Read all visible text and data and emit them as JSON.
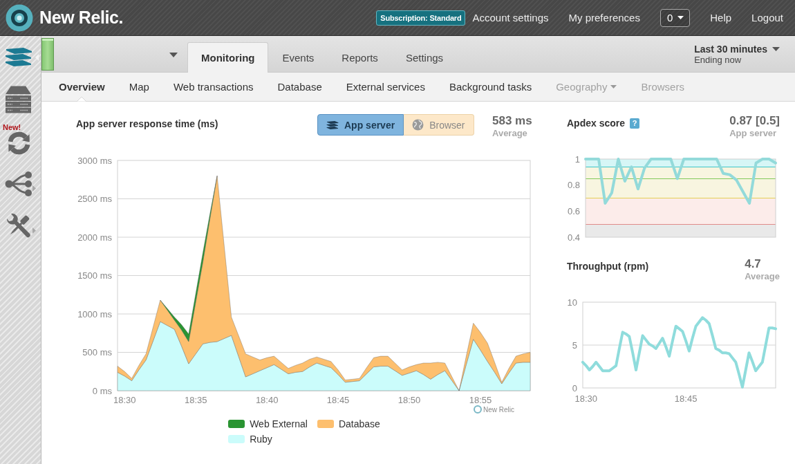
{
  "header": {
    "brand": "New Relic.",
    "menu": [
      {
        "kind": "badge",
        "label": "Subscription: Standard"
      },
      {
        "kind": "link",
        "label": "Account settings"
      },
      {
        "kind": "link",
        "label": "My preferences"
      },
      {
        "kind": "dropdown",
        "label": "0"
      },
      {
        "kind": "link",
        "label": "Help"
      },
      {
        "kind": "link",
        "label": "Logout"
      }
    ]
  },
  "sidebar": {
    "items": [
      {
        "selected": true,
        "submenu": false
      },
      {
        "selected": false,
        "submenu": false
      },
      {
        "badge": "New!",
        "selected": false,
        "submenu": false
      },
      {
        "selected": false,
        "submenu": true
      },
      {
        "selected": false,
        "submenu": true
      }
    ]
  },
  "tabs": [
    {
      "label": "Monitoring",
      "selected": true
    },
    {
      "label": "Events",
      "selected": false
    },
    {
      "label": "Reports",
      "selected": false
    },
    {
      "label": "Settings",
      "selected": false
    }
  ],
  "time_range": {
    "label": "Last 30 minutes",
    "sublabel": "Ending now"
  },
  "subnav": [
    {
      "label": "Overview",
      "selected": true,
      "disabled": false,
      "dropdown": false
    },
    {
      "label": "Map",
      "selected": false,
      "disabled": false,
      "dropdown": false
    },
    {
      "label": "Web transactions",
      "selected": false,
      "disabled": false,
      "dropdown": false
    },
    {
      "label": "Database",
      "selected": false,
      "disabled": false,
      "dropdown": false
    },
    {
      "label": "External services",
      "selected": false,
      "disabled": false,
      "dropdown": false
    },
    {
      "label": "Background tasks",
      "selected": false,
      "disabled": false,
      "dropdown": false
    },
    {
      "label": "Geography",
      "selected": false,
      "disabled": true,
      "dropdown": true
    },
    {
      "label": "Browsers",
      "selected": false,
      "disabled": true,
      "dropdown": false
    }
  ],
  "response_time": {
    "title": "App server response time (ms)",
    "toggle": [
      {
        "label": "App server",
        "selected": true
      },
      {
        "label": "Browser",
        "selected": false
      }
    ],
    "stat": {
      "value": "583 ms",
      "label": "Average"
    },
    "chart_data": {
      "type": "area",
      "stacked": true,
      "grid": true,
      "categories": [
        null,
        "18:30",
        null,
        null,
        null,
        null,
        null,
        null,
        null,
        null,
        null,
        "18:35",
        null,
        null,
        null,
        null,
        null,
        null,
        null,
        null,
        null,
        "18:40",
        null,
        null,
        null,
        null,
        null,
        null,
        null,
        null,
        null,
        "18:45",
        null,
        null,
        null,
        null,
        null,
        null,
        null,
        null,
        null,
        "18:50",
        null,
        null,
        null,
        null,
        null,
        null,
        null,
        null,
        null,
        "18:55",
        null,
        null,
        null,
        null,
        null,
        null,
        null
      ],
      "ylim": [
        0,
        3000
      ],
      "yticks": [
        {
          "value": 0,
          "label": "0 ms"
        },
        {
          "value": 500,
          "label": "500 ms"
        },
        {
          "value": 1000,
          "label": "1000 ms"
        },
        {
          "value": 1500,
          "label": "1500 ms"
        },
        {
          "value": 2000,
          "label": "2000 ms"
        },
        {
          "value": 2500,
          "label": "2500 ms"
        },
        {
          "value": 3000,
          "label": "3000 ms"
        }
      ],
      "series": [
        {
          "name": "Web External",
          "color": "#2a9432",
          "values": [
            null,
            null,
            null,
            null,
            null,
            null,
            0,
            20,
            40,
            70,
            100,
            110,
            120,
            60,
            0,
            null,
            null,
            null,
            null,
            null,
            null,
            null,
            null,
            null,
            null,
            null,
            null,
            null,
            null,
            null,
            null,
            null,
            null,
            null,
            null,
            null,
            null,
            null,
            null,
            null,
            null,
            null,
            null,
            null,
            null,
            null,
            null,
            null,
            null,
            null,
            null,
            null,
            null,
            null,
            null,
            null,
            null,
            null,
            null
          ]
        },
        {
          "name": "Database",
          "color": "#fdbf6e",
          "values": [
            80,
            60,
            30,
            60,
            80,
            180,
            280,
            200,
            120,
            210,
            290,
            680,
            1070,
            1620,
            2160,
            1200,
            240,
            270,
            300,
            220,
            140,
            130,
            110,
            90,
            70,
            90,
            110,
            100,
            80,
            80,
            80,
            60,
            30,
            30,
            30,
            80,
            120,
            130,
            130,
            100,
            70,
            80,
            80,
            150,
            210,
            160,
            100,
            50,
            0,
            110,
            210,
            230,
            240,
            130,
            20,
            60,
            90,
            110,
            130
          ]
        },
        {
          "name": "Ruby",
          "color": "#cbfcfb",
          "values": [
            240,
            190,
            130,
            270,
            400,
            650,
            900,
            850,
            800,
            580,
            350,
            480,
            610,
            630,
            640,
            680,
            720,
            450,
            180,
            220,
            260,
            300,
            340,
            280,
            220,
            240,
            250,
            310,
            360,
            330,
            300,
            210,
            110,
            120,
            130,
            220,
            310,
            320,
            320,
            260,
            200,
            230,
            260,
            210,
            150,
            210,
            260,
            130,
            0,
            340,
            670,
            530,
            380,
            240,
            90,
            230,
            360,
            370,
            370
          ]
        }
      ]
    },
    "credit": "New Relic"
  },
  "apdex": {
    "title": "Apdex score",
    "help": "?",
    "stat": {
      "value": "0.87 [0.5]",
      "label": "App server"
    },
    "chart_data": {
      "type": "line",
      "categories": [
        null,
        null,
        null,
        null,
        null,
        null,
        null,
        null,
        null,
        null,
        null,
        null,
        null,
        null,
        null,
        null,
        null,
        null,
        null,
        null,
        null,
        null,
        null,
        null,
        null,
        null,
        null,
        null,
        null,
        null
      ],
      "ylim": [
        0.4,
        1
      ],
      "yticks": [
        {
          "value": 0.4,
          "label": "0.4"
        },
        {
          "value": 0.6,
          "label": "0.6"
        },
        {
          "value": 0.8,
          "label": "0.8"
        },
        {
          "value": 1,
          "label": "1"
        }
      ],
      "series": [
        {
          "color": "#93dada",
          "values": [
            1,
            1,
            1,
            0.66,
            0.74,
            1,
            0.83,
            0.94,
            0.77,
            0.93,
            1,
            1,
            1,
            1,
            0.85,
            1,
            1,
            1,
            1,
            1,
            1,
            0.89,
            0.88,
            0.84,
            0.75,
            0.66,
            0.97,
            1,
            1,
            0.97
          ]
        }
      ]
    }
  },
  "throughput": {
    "title": "Throughput (rpm)",
    "stat": {
      "value": "4.7",
      "label": "Average"
    },
    "chart_data": {
      "type": "line",
      "grid": true,
      "categories": [
        null,
        "18:30",
        null,
        null,
        null,
        null,
        null,
        null,
        null,
        null,
        null,
        null,
        null,
        null,
        null,
        null,
        null,
        null,
        null,
        null,
        null,
        null,
        null,
        null,
        null,
        null,
        null,
        null,
        null,
        null,
        null,
        "18:45",
        null,
        null,
        null,
        null,
        null,
        null,
        null,
        null,
        null,
        null,
        null,
        null,
        null,
        null,
        null,
        null,
        null,
        null,
        null,
        null,
        null,
        null,
        null,
        null,
        null,
        null,
        null
      ],
      "ylim": [
        0,
        10
      ],
      "yticks": [
        {
          "value": 0,
          "label": "0"
        },
        {
          "value": 5,
          "label": "5"
        },
        {
          "value": 10,
          "label": "10"
        }
      ],
      "series": [
        {
          "color": "#8fdcdc",
          "values": [
            3.0,
            2.6,
            2.1,
            2.5,
            3.0,
            2.5,
            2.0,
            2.0,
            2.0,
            2.3,
            2.6,
            4.6,
            6.5,
            6.3,
            6.0,
            4.1,
            2.1,
            4.1,
            6.1,
            5.6,
            5.1,
            4.9,
            4.6,
            5.2,
            5.8,
            4.8,
            3.7,
            5.5,
            7.2,
            6.9,
            6.6,
            5.5,
            4.3,
            5.8,
            7.2,
            7.7,
            8.2,
            7.9,
            7.5,
            6.1,
            4.6,
            4.4,
            4.1,
            4.1,
            4.0,
            3.5,
            3.0,
            1.6,
            0.1,
            2.1,
            4.1,
            3.1,
            2.0,
            2.5,
            3.0,
            5.0,
            7.0,
            7.0,
            6.9
          ]
        }
      ]
    }
  }
}
